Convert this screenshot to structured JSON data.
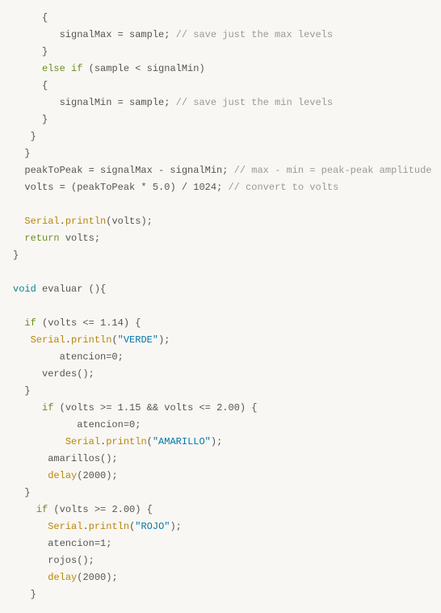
{
  "lines": [
    {
      "segs": [
        {
          "t": "     {",
          "c": ""
        }
      ]
    },
    {
      "segs": [
        {
          "t": "        signalMax = sample; ",
          "c": ""
        },
        {
          "t": "// save just the max levels",
          "c": "cm"
        }
      ]
    },
    {
      "segs": [
        {
          "t": "     }",
          "c": ""
        }
      ]
    },
    {
      "segs": [
        {
          "t": "     ",
          "c": ""
        },
        {
          "t": "else",
          "c": "kw"
        },
        {
          "t": " ",
          "c": ""
        },
        {
          "t": "if",
          "c": "kw"
        },
        {
          "t": " (sample < signalMin)",
          "c": ""
        }
      ]
    },
    {
      "segs": [
        {
          "t": "     {",
          "c": ""
        }
      ]
    },
    {
      "segs": [
        {
          "t": "        signalMin = sample; ",
          "c": ""
        },
        {
          "t": "// save just the min levels",
          "c": "cm"
        }
      ]
    },
    {
      "segs": [
        {
          "t": "     }",
          "c": ""
        }
      ]
    },
    {
      "segs": [
        {
          "t": "   }",
          "c": ""
        }
      ]
    },
    {
      "segs": [
        {
          "t": "  }",
          "c": ""
        }
      ]
    },
    {
      "segs": [
        {
          "t": "  peakToPeak = signalMax - signalMin; ",
          "c": ""
        },
        {
          "t": "// max - min = peak-peak amplitude",
          "c": "cm"
        }
      ]
    },
    {
      "segs": [
        {
          "t": "  volts = (peakToPeak * ",
          "c": ""
        },
        {
          "t": "5.0",
          "c": "nu"
        },
        {
          "t": ") / ",
          "c": ""
        },
        {
          "t": "1024",
          "c": "nu"
        },
        {
          "t": "; ",
          "c": ""
        },
        {
          "t": "// convert to volts",
          "c": "cm"
        }
      ]
    },
    {
      "segs": [
        {
          "t": " ",
          "c": ""
        }
      ]
    },
    {
      "segs": [
        {
          "t": "  ",
          "c": ""
        },
        {
          "t": "Serial",
          "c": "ob"
        },
        {
          "t": ".",
          "c": ""
        },
        {
          "t": "println",
          "c": "ob"
        },
        {
          "t": "(volts);",
          "c": ""
        }
      ]
    },
    {
      "segs": [
        {
          "t": "  ",
          "c": ""
        },
        {
          "t": "return",
          "c": "kw"
        },
        {
          "t": " volts;",
          "c": ""
        }
      ]
    },
    {
      "segs": [
        {
          "t": "}",
          "c": ""
        }
      ]
    },
    {
      "segs": [
        {
          "t": " ",
          "c": ""
        }
      ]
    },
    {
      "segs": [
        {
          "t": "void",
          "c": "ty"
        },
        {
          "t": " evaluar (){",
          "c": ""
        }
      ]
    },
    {
      "segs": [
        {
          "t": " ",
          "c": ""
        }
      ]
    },
    {
      "segs": [
        {
          "t": "  ",
          "c": ""
        },
        {
          "t": "if",
          "c": "kw"
        },
        {
          "t": " (volts <= ",
          "c": ""
        },
        {
          "t": "1.14",
          "c": "nu"
        },
        {
          "t": ") {",
          "c": ""
        }
      ]
    },
    {
      "segs": [
        {
          "t": "   ",
          "c": ""
        },
        {
          "t": "Serial",
          "c": "ob"
        },
        {
          "t": ".",
          "c": ""
        },
        {
          "t": "println",
          "c": "ob"
        },
        {
          "t": "(",
          "c": ""
        },
        {
          "t": "\"VERDE\"",
          "c": "st"
        },
        {
          "t": ");",
          "c": ""
        }
      ]
    },
    {
      "segs": [
        {
          "t": "        atencion=",
          "c": ""
        },
        {
          "t": "0",
          "c": "nu"
        },
        {
          "t": ";",
          "c": ""
        }
      ]
    },
    {
      "segs": [
        {
          "t": "     verdes();",
          "c": ""
        }
      ]
    },
    {
      "segs": [
        {
          "t": "  }",
          "c": ""
        }
      ]
    },
    {
      "segs": [
        {
          "t": "     ",
          "c": ""
        },
        {
          "t": "if",
          "c": "kw"
        },
        {
          "t": " (volts >= ",
          "c": ""
        },
        {
          "t": "1.15",
          "c": "nu"
        },
        {
          "t": " && volts <= ",
          "c": ""
        },
        {
          "t": "2.00",
          "c": "nu"
        },
        {
          "t": ") {",
          "c": ""
        }
      ]
    },
    {
      "segs": [
        {
          "t": "           atencion=",
          "c": ""
        },
        {
          "t": "0",
          "c": "nu"
        },
        {
          "t": ";",
          "c": ""
        }
      ]
    },
    {
      "segs": [
        {
          "t": "         ",
          "c": ""
        },
        {
          "t": "Serial",
          "c": "ob"
        },
        {
          "t": ".",
          "c": ""
        },
        {
          "t": "println",
          "c": "ob"
        },
        {
          "t": "(",
          "c": ""
        },
        {
          "t": "\"AMARILLO\"",
          "c": "st"
        },
        {
          "t": ");",
          "c": ""
        }
      ]
    },
    {
      "segs": [
        {
          "t": "      amarillos();",
          "c": ""
        }
      ]
    },
    {
      "segs": [
        {
          "t": "      ",
          "c": ""
        },
        {
          "t": "delay",
          "c": "ob"
        },
        {
          "t": "(",
          "c": ""
        },
        {
          "t": "2000",
          "c": "nu"
        },
        {
          "t": ");",
          "c": ""
        }
      ]
    },
    {
      "segs": [
        {
          "t": "  }",
          "c": ""
        }
      ]
    },
    {
      "segs": [
        {
          "t": "    ",
          "c": ""
        },
        {
          "t": "if",
          "c": "kw"
        },
        {
          "t": " (volts >= ",
          "c": ""
        },
        {
          "t": "2.00",
          "c": "nu"
        },
        {
          "t": ") {",
          "c": ""
        }
      ]
    },
    {
      "segs": [
        {
          "t": "      ",
          "c": ""
        },
        {
          "t": "Serial",
          "c": "ob"
        },
        {
          "t": ".",
          "c": ""
        },
        {
          "t": "println",
          "c": "ob"
        },
        {
          "t": "(",
          "c": ""
        },
        {
          "t": "\"ROJO\"",
          "c": "st"
        },
        {
          "t": ");",
          "c": ""
        }
      ]
    },
    {
      "segs": [
        {
          "t": "      atencion=",
          "c": ""
        },
        {
          "t": "1",
          "c": "nu"
        },
        {
          "t": ";",
          "c": ""
        }
      ]
    },
    {
      "segs": [
        {
          "t": "      rojos();",
          "c": ""
        }
      ]
    },
    {
      "segs": [
        {
          "t": "      ",
          "c": ""
        },
        {
          "t": "delay",
          "c": "ob"
        },
        {
          "t": "(",
          "c": ""
        },
        {
          "t": "2000",
          "c": "nu"
        },
        {
          "t": ");",
          "c": ""
        }
      ]
    },
    {
      "segs": [
        {
          "t": "   }",
          "c": ""
        }
      ]
    }
  ]
}
